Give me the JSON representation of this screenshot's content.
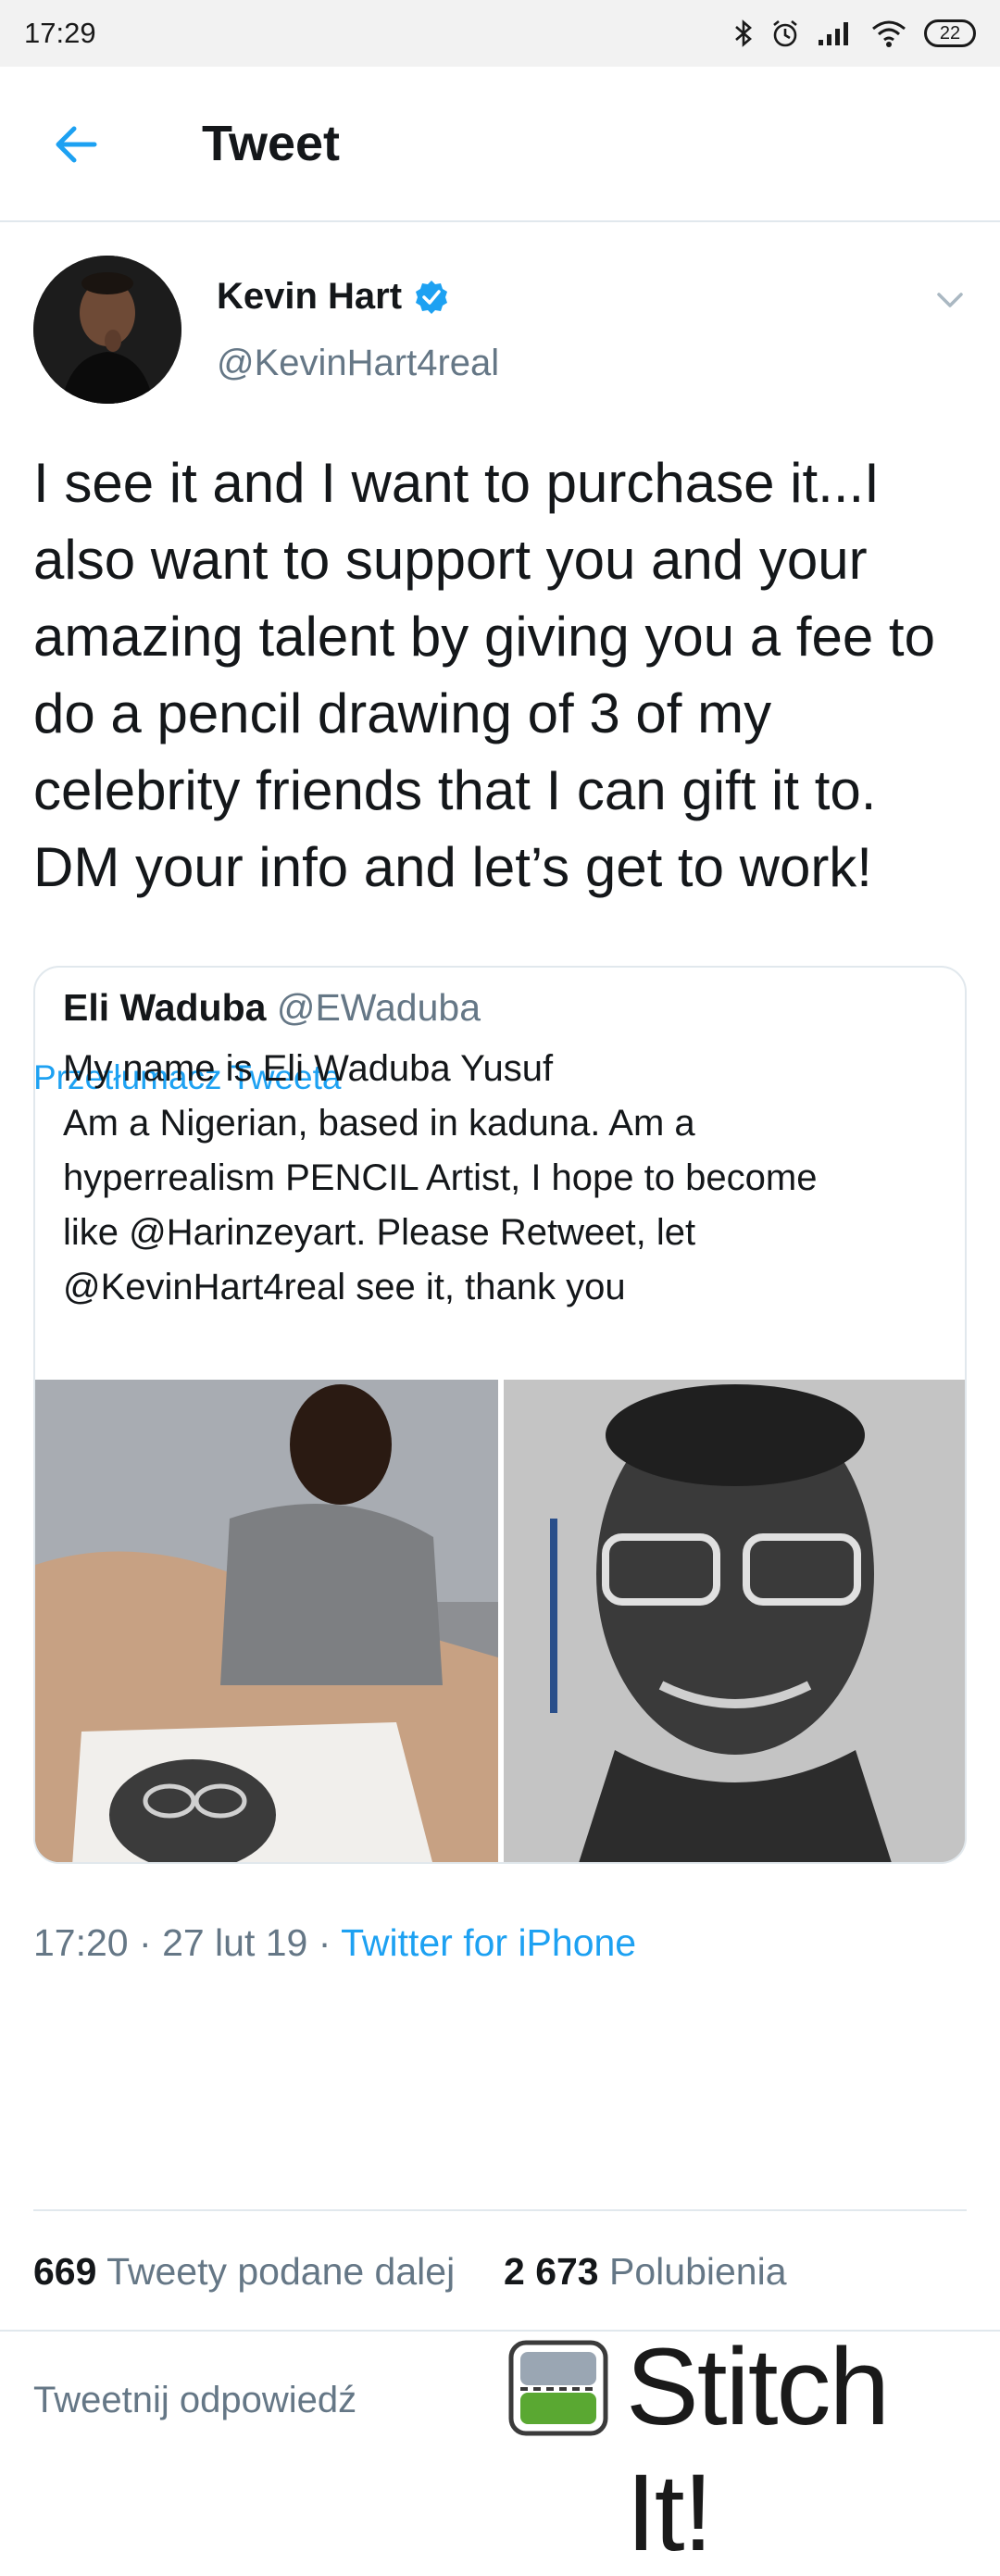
{
  "status_bar": {
    "time": "17:29",
    "battery": "22",
    "icons": [
      "bluetooth-icon",
      "alarm-icon",
      "signal-icon",
      "wifi-icon",
      "battery-icon"
    ]
  },
  "app_bar": {
    "title": "Tweet",
    "back_icon": "arrow-left-icon"
  },
  "tweet": {
    "author_name": "Kevin Hart",
    "author_handle": "@KevinHart4real",
    "verified": true,
    "text": "I see it and I want to purchase it...I also want to support you and your amazing talent by giving you a fee to do a pencil drawing of 3 of my celebrity friends that I can gift it to. DM your info and let’s get to work!",
    "translate_label": "Przetłumacz Tweeta",
    "time": "17:20",
    "date": "27 lut 19",
    "source": "Twitter for iPhone"
  },
  "quote": {
    "author_name": "Eli Waduba",
    "author_handle": "@EWaduba",
    "text_lines": [
      "My name is Eli Waduba Yusuf",
      "Am a Nigerian, based in kaduna. Am a",
      "hyperrealism PENCIL Artist, I hope to become",
      "like @Harinzeyart. Please Retweet, let",
      "@KevinHart4real see it, thank you"
    ]
  },
  "stats": {
    "retweets_count": "669",
    "retweets_label": "Tweety podane dalej",
    "likes_count": "2 673",
    "likes_label": "Polubienia"
  },
  "reply": {
    "placeholder": "Tweetnij odpowiedź"
  },
  "watermark": {
    "text": "Stitch It!"
  },
  "colors": {
    "accent": "#1da1f2",
    "secondary_text": "#657786",
    "border": "#e1e8ed"
  }
}
